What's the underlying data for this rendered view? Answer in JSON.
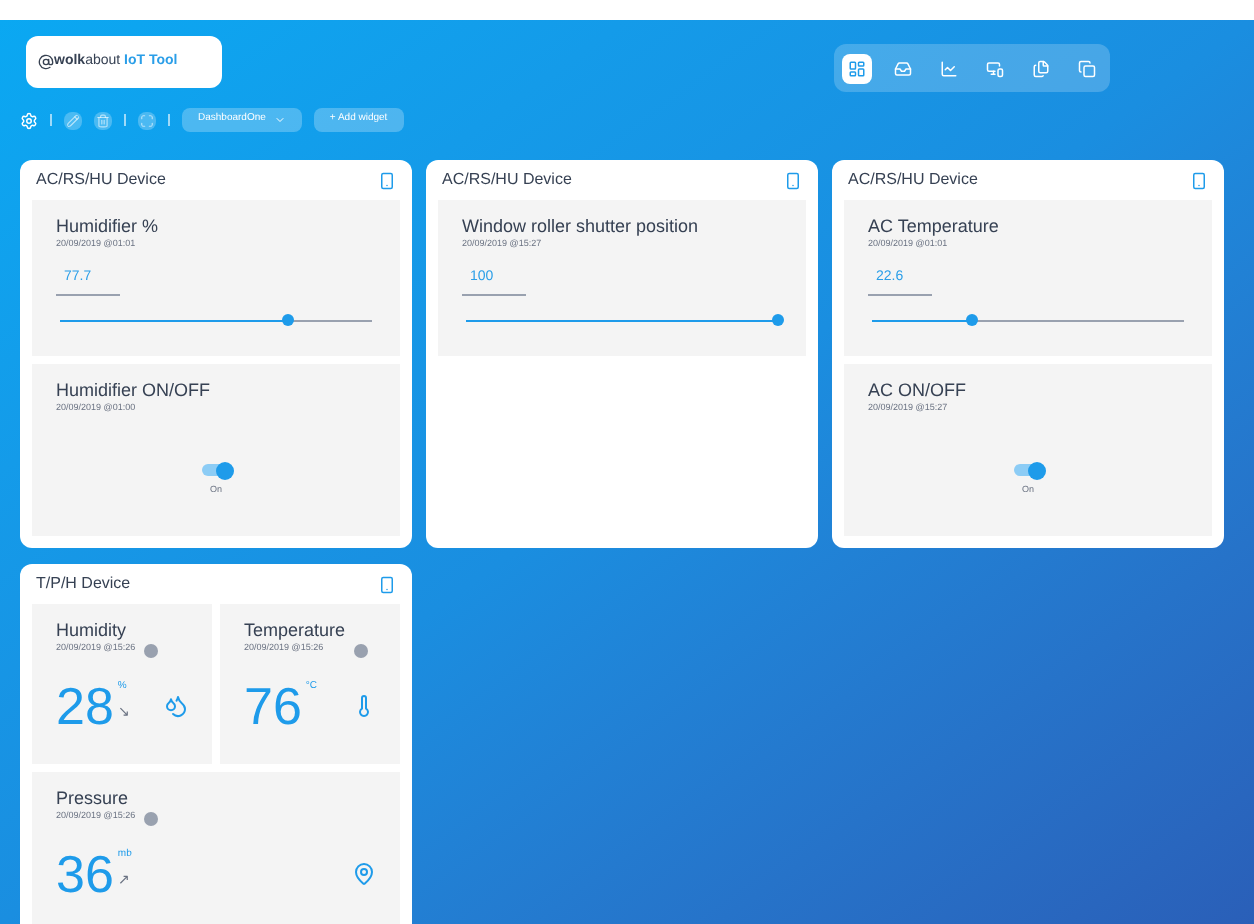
{
  "logo": {
    "brand_bold": "wolk",
    "brand": "about",
    "product": "IoT Tool"
  },
  "toolbar": {
    "dashboard": "DashboardOne",
    "add_button": "+ Add widget"
  },
  "nav": [
    {
      "selected": true
    },
    {
      "selected": false
    },
    {
      "selected": false
    },
    {
      "selected": false
    },
    {
      "selected": false
    },
    {
      "selected": false
    }
  ],
  "devices": [
    {
      "title": "AC/RS/HU Device",
      "widgets": [
        {
          "kind": "slider",
          "name": "Humidifier %",
          "time": "20/09/2019 @01:01",
          "value": "77.7",
          "level": 0.73
        },
        {
          "kind": "switch",
          "name": "Humidifier ON/OFF",
          "time": "20/09/2019 @01:00",
          "on": true,
          "state": "On"
        }
      ]
    },
    {
      "title": "AC/RS/HU Device",
      "widgets": [
        {
          "kind": "slider",
          "name": "Window roller shutter position",
          "time": "20/09/2019 @15:27",
          "value": "100",
          "level": 1.0
        }
      ]
    },
    {
      "title": "AC/RS/HU Device",
      "widgets": [
        {
          "kind": "slider",
          "name": "AC Temperature",
          "time": "20/09/2019 @01:01",
          "value": "22.6",
          "level": 0.32
        },
        {
          "kind": "switch",
          "name": "AC ON/OFF",
          "time": "20/09/2019 @15:27",
          "on": true,
          "state": "On"
        }
      ]
    },
    {
      "title": "T/P/H Device",
      "widgets": [
        {
          "kind": "reading",
          "name": "Humidity",
          "time": "20/09/2019 @15:26",
          "value": "28",
          "unit": "%",
          "trend": "↘"
        },
        {
          "kind": "reading",
          "name": "Temperature",
          "time": "20/09/2019 @15:26",
          "value": "76",
          "unit": "°C"
        },
        {
          "kind": "reading",
          "name": "Pressure",
          "time": "20/09/2019 @15:26",
          "value": "36",
          "unit": "mb",
          "trend": "↗"
        }
      ]
    }
  ]
}
